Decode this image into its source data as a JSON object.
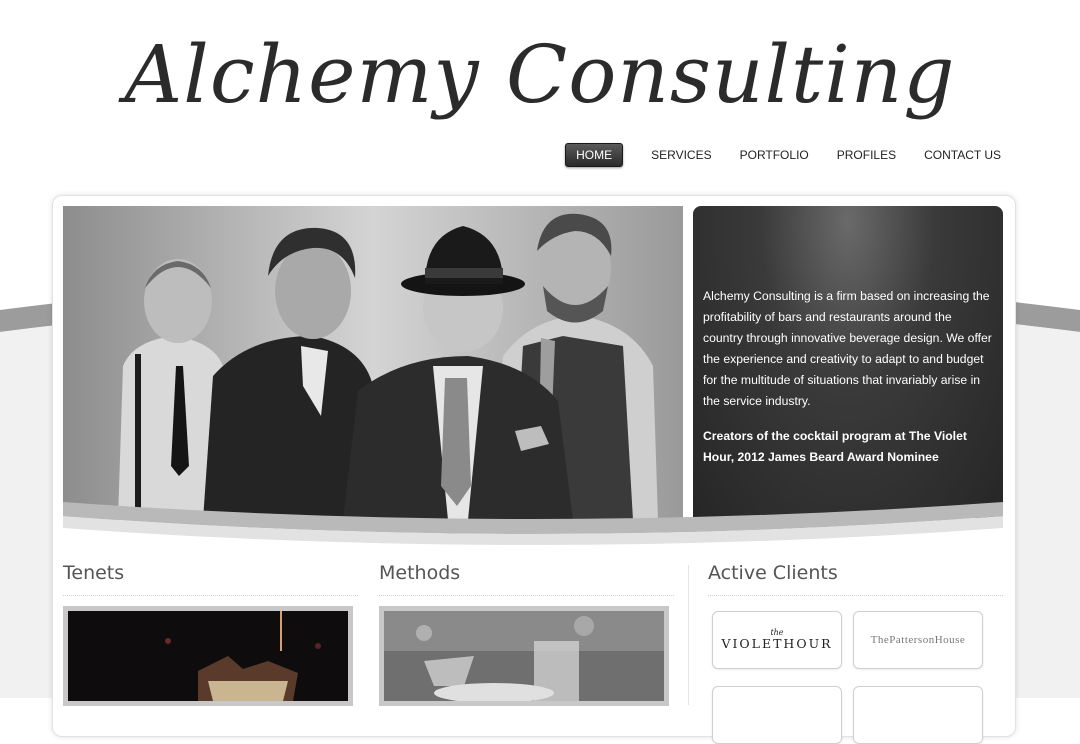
{
  "site": {
    "logo_text": "Alchemy Consulting"
  },
  "nav": {
    "items": [
      {
        "label": "HOME",
        "active": true
      },
      {
        "label": "SERVICES",
        "active": false
      },
      {
        "label": "PORTFOLIO",
        "active": false
      },
      {
        "label": "PROFILES",
        "active": false
      },
      {
        "label": "CONTACT US",
        "active": false
      }
    ]
  },
  "hero": {
    "description": "Alchemy Consulting is a firm based on increasing the profitability of bars and restaurants around the country through innovative beverage design. We offer the experience and creativity to adapt to and budget for the multitude of situations that invariably arise in the service industry.",
    "highlight": "Creators of the cocktail program at The Violet Hour, 2012 James Beard Award Nominee"
  },
  "columns": {
    "tenets": {
      "title": "Tenets"
    },
    "methods": {
      "title": "Methods"
    },
    "clients": {
      "title": "Active Clients",
      "logos": [
        {
          "the": "the",
          "name": "VIOLETHOUR"
        },
        {
          "name": "ThePattersonHouse"
        }
      ]
    }
  },
  "colors": {
    "nav_active_bg": "#3a3a3a",
    "hero_panel_bg": "#2a2a2a",
    "logo_text": "#2b2b2b",
    "heading_text": "#555555"
  }
}
